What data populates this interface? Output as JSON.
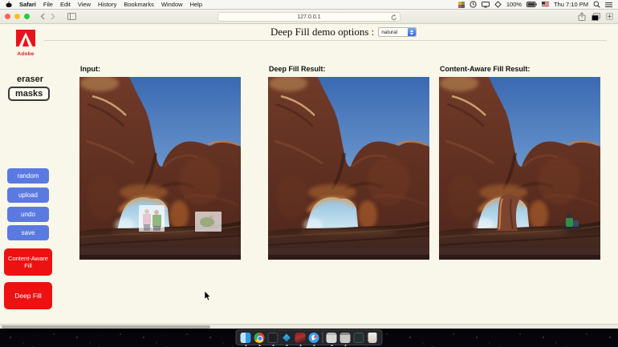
{
  "menu_bar": {
    "icons_left": [
      "apple-icon"
    ],
    "items": [
      "Safari",
      "File",
      "Edit",
      "View",
      "History",
      "Bookmarks",
      "Window",
      "Help"
    ],
    "icons_right": [
      "status-app-icon",
      "clock-icon",
      "display-icon",
      "siri-icon",
      "battery-icon",
      "us-flag-icon",
      "search-icon",
      "menu-list-icon"
    ],
    "status": {
      "battery_percent": "100%",
      "datetime": "Thu 7:10 PM"
    }
  },
  "browser": {
    "address": "127.0.0.1",
    "toolbar_icons": [
      "back-icon",
      "forward-icon",
      "sidebar-icon",
      "reload-icon",
      "share-icon",
      "tab-overview-icon",
      "new-tab-icon"
    ]
  },
  "page": {
    "logo": "Adobe",
    "options_label": "Deep Fill demo options :",
    "options_value": "natural",
    "sidebar": {
      "eraser": "eraser",
      "masks": "masks",
      "buttons": [
        "random",
        "upload",
        "undo",
        "save"
      ],
      "fill_buttons": [
        "Content-Aware Fill",
        "Deep Fill"
      ]
    },
    "figures": [
      {
        "label": "Input:"
      },
      {
        "label": "Deep Fill Result:"
      },
      {
        "label": "Content-Aware Fill Result:"
      }
    ]
  },
  "dock": {
    "icons": [
      "finder-icon",
      "chrome-icon",
      "terminal-icon",
      "virtualbox-icon",
      "photos-icon",
      "safari-icon",
      "minimized-window-1",
      "minimized-window-2",
      "dark-app-icon",
      "trash-icon"
    ]
  },
  "colors": {
    "accent_blue": "#5a7ae2",
    "accent_red": "#ee1111",
    "page_bg": "#f9f7ea",
    "adobe_red": "#e8131d"
  }
}
